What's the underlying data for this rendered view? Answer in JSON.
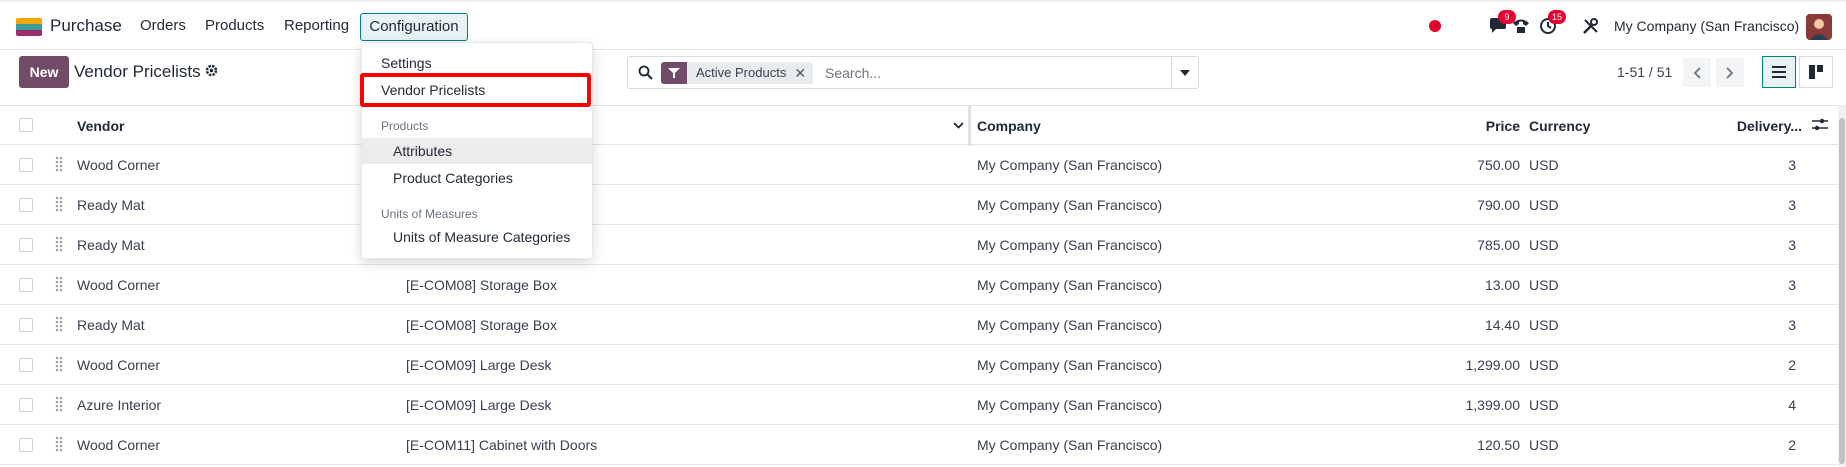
{
  "app": {
    "name": "Purchase",
    "brand_colors": [
      "#f7a600",
      "#5b8c8b",
      "#9b2f6e"
    ]
  },
  "navbar": {
    "menus": [
      "Orders",
      "Products",
      "Reporting"
    ],
    "active_menu": "Configuration",
    "messages_badge": "9",
    "activities_badge": "15",
    "company": "My Company (San Francisco)"
  },
  "control": {
    "new_label": "New",
    "title": "Vendor Pricelists",
    "facet_label": "Active Products",
    "search_placeholder": "Search...",
    "pager": "1-51 / 51"
  },
  "dropdown": {
    "settings": "Settings",
    "vendor_pricelists": "Vendor Pricelists",
    "products_header": "Products",
    "attributes": "Attributes",
    "product_categories": "Product Categories",
    "uom_header": "Units of Measures",
    "uom_categories": "Units of Measure Categories"
  },
  "table": {
    "columns": {
      "vendor": "Vendor",
      "company": "Company",
      "price": "Price",
      "currency": "Currency",
      "delivery": "Delivery..."
    },
    "rows": [
      {
        "vendor": "Wood Corner",
        "product": "",
        "company": "My Company (San Francisco)",
        "price": "750.00",
        "currency": "USD",
        "delivery": "3"
      },
      {
        "vendor": "Ready Mat",
        "product": "",
        "company": "My Company (San Francisco)",
        "price": "790.00",
        "currency": "USD",
        "delivery": "3"
      },
      {
        "vendor": "Ready Mat",
        "product": "",
        "company": "My Company (San Francisco)",
        "price": "785.00",
        "currency": "USD",
        "delivery": "3"
      },
      {
        "vendor": "Wood Corner",
        "product": "[E-COM08] Storage Box",
        "company": "My Company (San Francisco)",
        "price": "13.00",
        "currency": "USD",
        "delivery": "3"
      },
      {
        "vendor": "Ready Mat",
        "product": "[E-COM08] Storage Box",
        "company": "My Company (San Francisco)",
        "price": "14.40",
        "currency": "USD",
        "delivery": "3"
      },
      {
        "vendor": "Wood Corner",
        "product": "[E-COM09] Large Desk",
        "company": "My Company (San Francisco)",
        "price": "1,299.00",
        "currency": "USD",
        "delivery": "2"
      },
      {
        "vendor": "Azure Interior",
        "product": "[E-COM09] Large Desk",
        "company": "My Company (San Francisco)",
        "price": "1,399.00",
        "currency": "USD",
        "delivery": "4"
      },
      {
        "vendor": "Wood Corner",
        "product": "[E-COM11] Cabinet with Doors",
        "company": "My Company (San Francisco)",
        "price": "120.50",
        "currency": "USD",
        "delivery": "2"
      }
    ]
  }
}
